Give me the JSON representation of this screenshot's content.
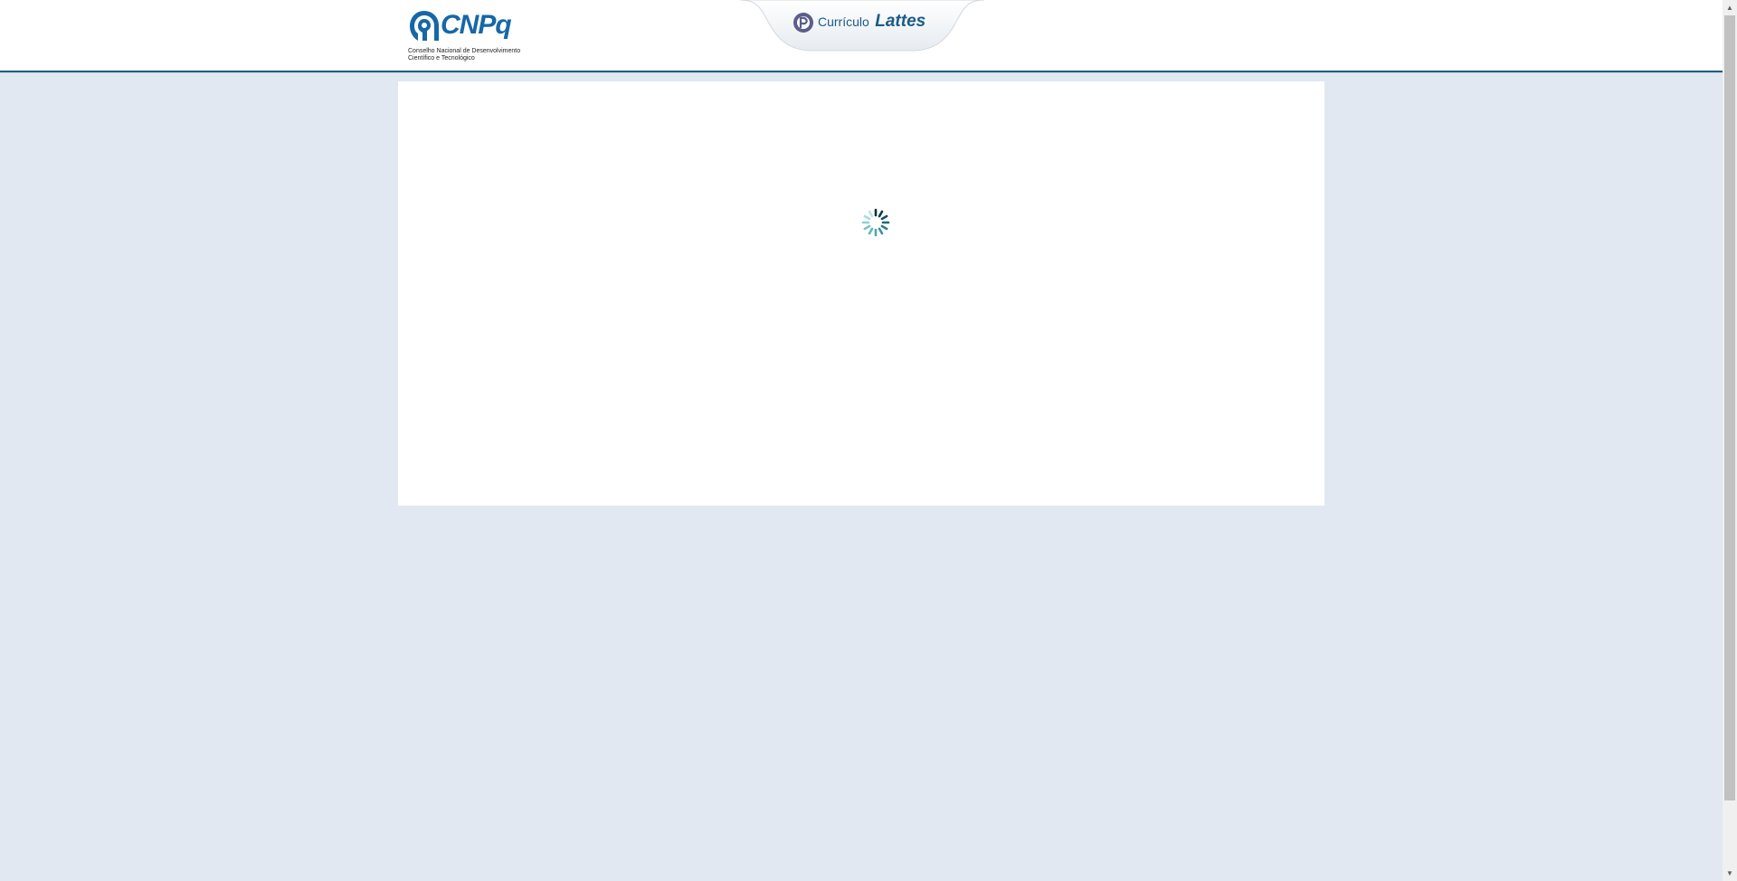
{
  "header": {
    "logo": {
      "wordmark": "CNPq",
      "subtitle_line1": "Conselho Nacional de Desenvolvimento",
      "subtitle_line2": "Científico e Tecnológico",
      "icon": "cnpq-head-icon"
    },
    "tab": {
      "label_part1": "Currículo",
      "label_part2": "Lattes",
      "icon": "lattes-icon"
    }
  },
  "content": {
    "state": "loading",
    "spinner_icon": "loading-spinner-icon"
  },
  "colors": {
    "background": "#e1e8f1",
    "header_border": "#1e5f7e",
    "brand_blue": "#1667a8",
    "spinner_teal": "#3aa3a3"
  }
}
